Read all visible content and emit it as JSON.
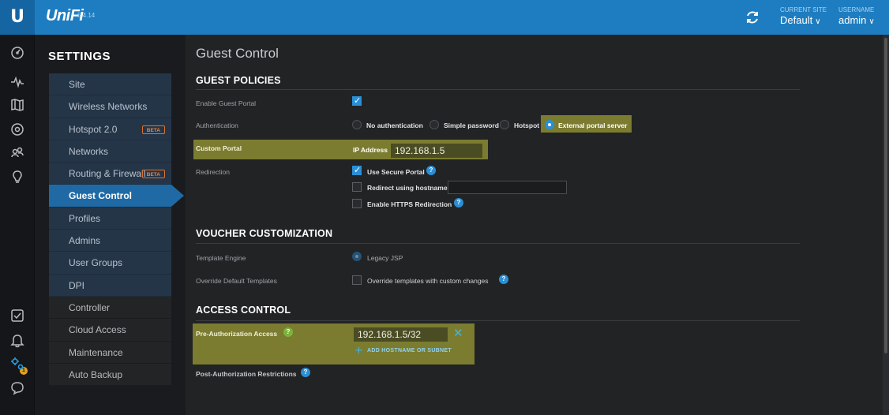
{
  "topbar": {
    "logo": "U",
    "brand": "UniFi",
    "version": "5.4.14",
    "current_site_caption": "CURRENT SITE",
    "current_site_value": "Default",
    "username_caption": "USERNAME",
    "username_value": "admin",
    "dropdown_glyph": "∨"
  },
  "rail": {
    "icons": [
      "dashboard-icon",
      "statistics-icon",
      "map-icon",
      "devices-icon",
      "clients-icon",
      "insights-icon",
      "tasks-icon",
      "alerts-icon",
      "settings-icon",
      "chat-icon"
    ],
    "alert_count": "1"
  },
  "nav": {
    "title": "SETTINGS",
    "beta_label": "BETA",
    "items": [
      {
        "label": "Site"
      },
      {
        "label": "Wireless Networks"
      },
      {
        "label": "Hotspot 2.0"
      },
      {
        "label": "Networks"
      },
      {
        "label": "Routing & Firewall"
      },
      {
        "label": "Guest Control"
      },
      {
        "label": "Profiles"
      },
      {
        "label": "Admins"
      },
      {
        "label": "User Groups"
      },
      {
        "label": "DPI"
      },
      {
        "label": "Controller"
      },
      {
        "label": "Cloud Access"
      },
      {
        "label": "Maintenance"
      },
      {
        "label": "Auto Backup"
      }
    ]
  },
  "main": {
    "page_title": "Guest Control",
    "guest_policies": {
      "title": "GUEST POLICIES",
      "enable_portal_label": "Enable Guest Portal",
      "authentication_label": "Authentication",
      "auth_options": [
        "No authentication",
        "Simple password",
        "Hotspot",
        "External portal server"
      ],
      "auth_selected": "External portal server",
      "custom_portal_label": "Custom Portal",
      "ip_address_label": "IP Address",
      "ip_address_value": "192.168.1.5",
      "redirection_label": "Redirection",
      "use_secure_portal": "Use Secure Portal",
      "redirect_hostname": "Redirect using hostname",
      "redirect_hostname_value": "",
      "enable_https_redirection": "Enable HTTPS Redirection"
    },
    "voucher": {
      "title": "VOUCHER CUSTOMIZATION",
      "template_engine_label": "Template Engine",
      "template_engine_value": "Legacy JSP",
      "override_label": "Override Default Templates",
      "override_option": "Override templates with custom changes"
    },
    "access_control": {
      "title": "ACCESS CONTROL",
      "pre_auth_label": "Pre-Authorization Access",
      "pre_auth_value": "192.168.1.5/32",
      "add_hostname_label": "ADD HOSTNAME OR SUBNET",
      "post_auth_label": "Post-Authorization Restrictions",
      "help_glyph": "?",
      "remove_glyph": "✕",
      "add_glyph": "+"
    }
  },
  "colors": {
    "topbar": "#1e7dc0",
    "nav_item": "#253548",
    "nav_active": "#1f6aa5",
    "highlight": "#c4c73a",
    "accent": "#2a8fd6",
    "beta": "#e2702a"
  }
}
